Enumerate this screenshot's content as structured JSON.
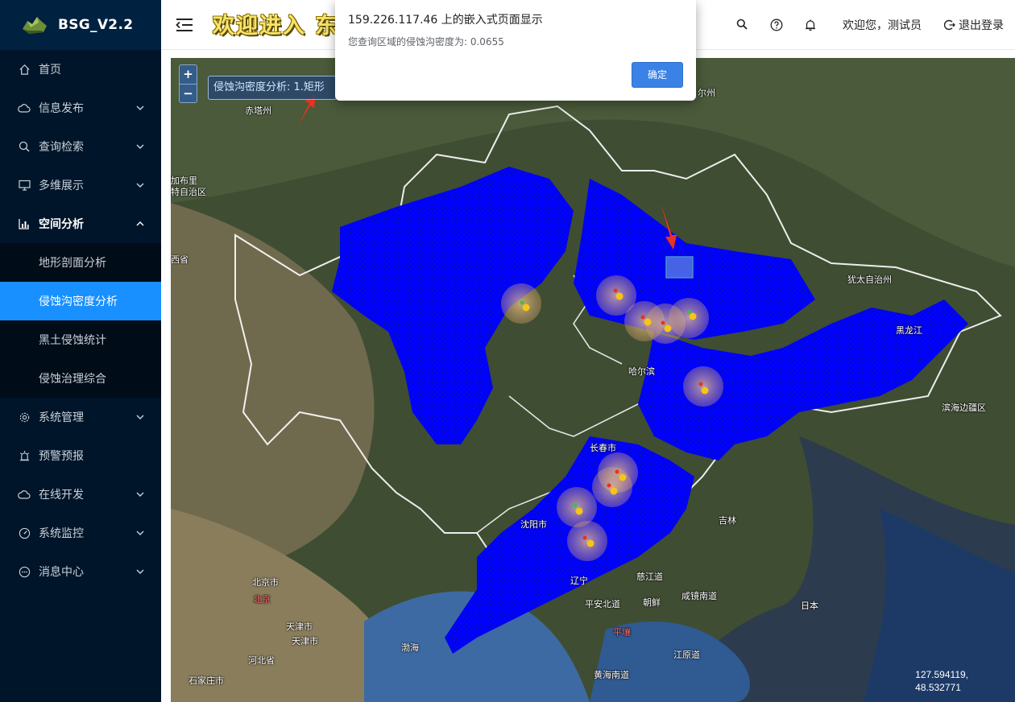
{
  "app": {
    "name": "BSG_V2.2"
  },
  "sidebar": {
    "items": [
      {
        "label": "首页",
        "icon": "home-icon"
      },
      {
        "label": "信息发布",
        "icon": "cloud-icon"
      },
      {
        "label": "查询检索",
        "icon": "search-icon"
      },
      {
        "label": "多维展示",
        "icon": "monitor-icon"
      },
      {
        "label": "空间分析",
        "icon": "bar-chart-icon",
        "open": true
      },
      {
        "label": "系统管理",
        "icon": "gear-icon"
      },
      {
        "label": "预警预报",
        "icon": "alarm-icon"
      },
      {
        "label": "在线开发",
        "icon": "cloud-icon"
      },
      {
        "label": "系统监控",
        "icon": "dashboard-icon"
      },
      {
        "label": "消息中心",
        "icon": "message-icon"
      }
    ],
    "submenu": [
      {
        "label": "地形剖面分析"
      },
      {
        "label": "侵蚀沟密度分析",
        "active": true
      },
      {
        "label": "黑土侵蚀统计"
      },
      {
        "label": "侵蚀治理综合"
      }
    ]
  },
  "header": {
    "banner": "欢迎进入 东北",
    "welcome": "欢迎您，测试员",
    "logout": "退出登录"
  },
  "map": {
    "tool_label": "侵蚀沟密度分析:  1.矩形",
    "zoom_in": "+",
    "zoom_out": "−",
    "coord_lon": "127.594119,",
    "coord_lat": "48.532771",
    "labels": [
      "赤塔州",
      "加布里",
      "特自治区",
      "西省",
      "犹太自治州",
      "哈尔滨",
      "长春市",
      "沈阳市",
      "北京市",
      "北京",
      "天津市",
      "天津市",
      "河北省",
      "石家庄市",
      "滨海边疆区",
      "黑龙江",
      "吉林",
      "辽宁",
      "平安北道",
      "朝鲜",
      "咸镜南道",
      "慈江道",
      "江原道",
      "平壤",
      "黄海南道",
      "渤海",
      "日本",
      "尔州"
    ]
  },
  "dialog": {
    "title": "159.226.117.46 上的嵌入式页面显示",
    "message": "您查询区域的侵蚀沟密度为:  0.0655",
    "ok": "确定"
  },
  "colors": {
    "sidebar_bg": "#001529",
    "active": "#1890ff",
    "density": "#0000ff",
    "arrow": "#e8321e"
  }
}
